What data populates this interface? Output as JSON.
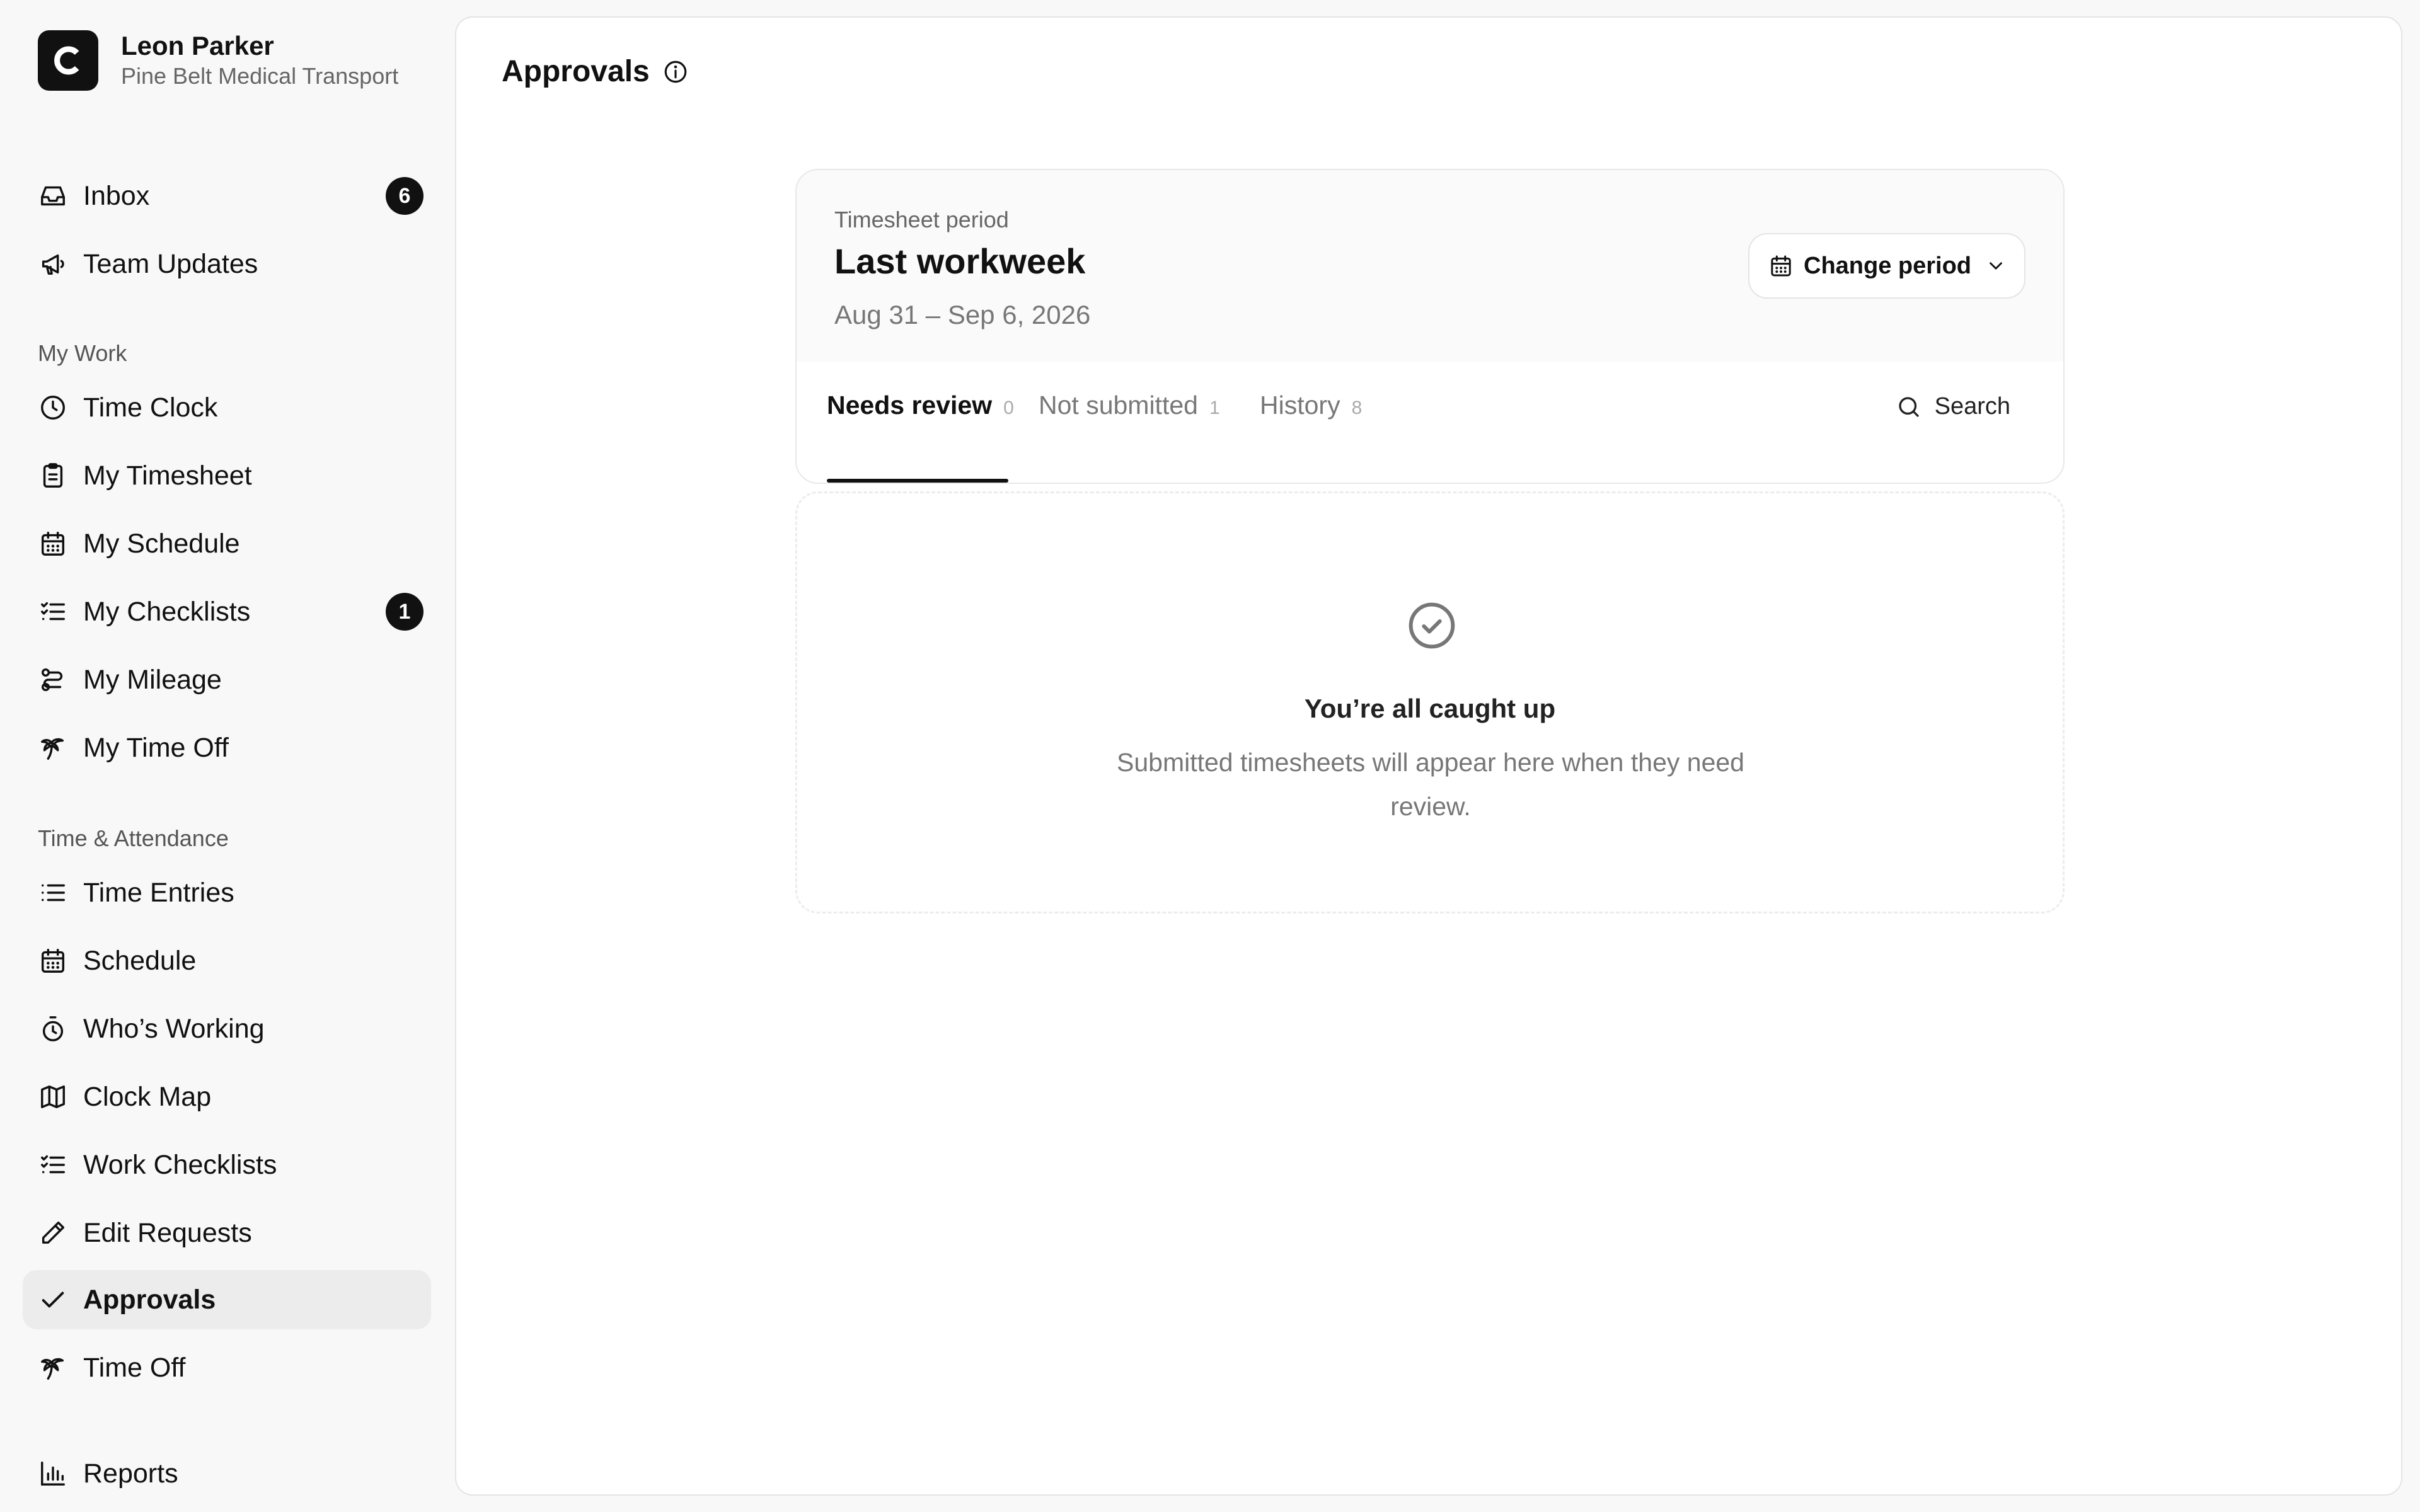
{
  "brand": {
    "logo_letter": "C",
    "user_name": "Leon Parker",
    "org_name": "Pine Belt Medical Transport"
  },
  "sidebar": {
    "top_items": [
      {
        "label": "Inbox",
        "icon": "inbox-icon",
        "badge": "6"
      },
      {
        "label": "Team Updates",
        "icon": "megaphone-icon"
      }
    ],
    "sections": [
      {
        "title": "My Work",
        "items": [
          {
            "label": "Time Clock",
            "icon": "clock-icon"
          },
          {
            "label": "My Timesheet",
            "icon": "clipboard-icon"
          },
          {
            "label": "My Schedule",
            "icon": "calendar-icon"
          },
          {
            "label": "My Checklists",
            "icon": "checklist-icon",
            "badge": "1"
          },
          {
            "label": "My Mileage",
            "icon": "route-icon"
          },
          {
            "label": "My Time Off",
            "icon": "palm-tree-icon"
          }
        ]
      },
      {
        "title": "Time & Attendance",
        "items": [
          {
            "label": "Time Entries",
            "icon": "list-icon"
          },
          {
            "label": "Schedule",
            "icon": "calendar-icon"
          },
          {
            "label": "Who’s Working",
            "icon": "stopwatch-icon"
          },
          {
            "label": "Clock Map",
            "icon": "map-icon"
          },
          {
            "label": "Work Checklists",
            "icon": "checklist-icon"
          },
          {
            "label": "Edit Requests",
            "icon": "pencil-icon"
          },
          {
            "label": "Approvals",
            "icon": "check-icon",
            "active": true
          },
          {
            "label": "Time Off",
            "icon": "palm-tree-icon"
          }
        ]
      }
    ],
    "bottom_items": [
      {
        "label": "Reports",
        "icon": "bar-chart-icon"
      }
    ]
  },
  "main": {
    "title": "Approvals",
    "period": {
      "label": "Timesheet period",
      "name": "Last workweek",
      "range": "Aug 31 – Sep 6, 2026",
      "change_label": "Change period"
    },
    "tabs": [
      {
        "label": "Needs review",
        "count": "0",
        "active": true
      },
      {
        "label": "Not submitted",
        "count": "1"
      },
      {
        "label": "History",
        "count": "8"
      }
    ],
    "search_label": "Search",
    "empty": {
      "title": "You’re all caught up",
      "description": "Submitted timesheets will appear here when they need review."
    }
  },
  "colors": {
    "accent": "#111111",
    "active_bg": "#ececec",
    "page_bg": "#f8f8f8"
  }
}
